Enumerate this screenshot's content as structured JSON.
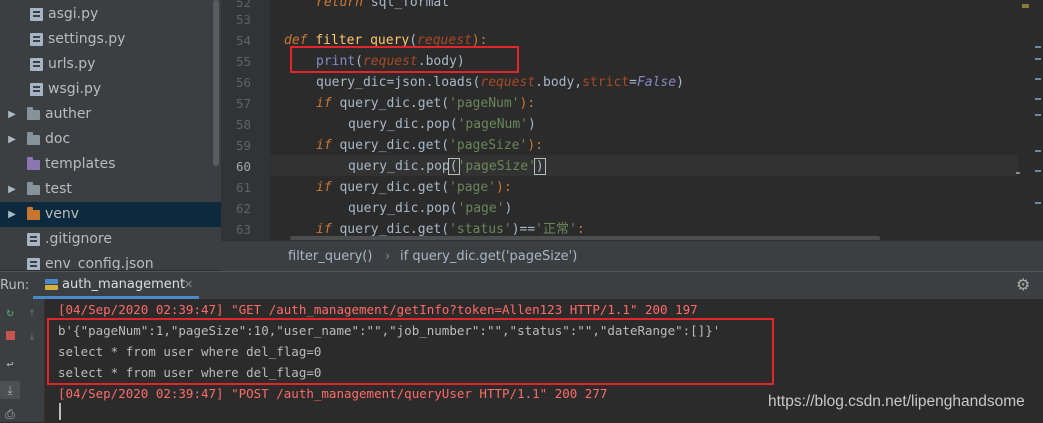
{
  "project_tree": {
    "items": [
      {
        "label": "asgi.py",
        "kind": "file"
      },
      {
        "label": "settings.py",
        "kind": "file"
      },
      {
        "label": "urls.py",
        "kind": "file"
      },
      {
        "label": "wsgi.py",
        "kind": "file"
      },
      {
        "label": "auther",
        "kind": "folder"
      },
      {
        "label": "doc",
        "kind": "folder"
      },
      {
        "label": "templates",
        "kind": "folder"
      },
      {
        "label": "test",
        "kind": "folder"
      },
      {
        "label": "venv",
        "kind": "folder"
      },
      {
        "label": ".gitignore",
        "kind": "file"
      },
      {
        "label": "env_config.json",
        "kind": "file"
      }
    ]
  },
  "editor": {
    "line_numbers": [
      "52",
      "53",
      "54",
      "55",
      "56",
      "57",
      "58",
      "59",
      "60",
      "61",
      "62",
      "63"
    ],
    "lines": {
      "l52": {
        "kw": "return",
        "rest": " sql_format"
      },
      "l54": {
        "kw": "def",
        "fn": "filter_query",
        "open": "(",
        "param": "request",
        "close": "):"
      },
      "l55": {
        "print": "print",
        "open": "(",
        "param": "request",
        "rest": ".body)"
      },
      "l56": {
        "a": "query_dic=json.loads(",
        "param": "request",
        "b": ".body,",
        "kwarg": "strict",
        "eq": "=",
        "const": "False",
        "c": ")"
      },
      "l57": {
        "kw": "if",
        "a": " query_dic.get(",
        "str": "'pageNum'",
        "b": "):"
      },
      "l58": {
        "a": "query_dic.pop(",
        "str": "'pageNum'",
        "b": ")"
      },
      "l59": {
        "kw": "if",
        "a": " query_dic.get(",
        "str": "'pageSize'",
        "b": "):"
      },
      "l60": {
        "a": "query_dic.pop",
        "open": "(",
        "str": "'pageSize'",
        "close": ")"
      },
      "l61": {
        "kw": "if",
        "a": " query_dic.get(",
        "str": "'page'",
        "b": "):"
      },
      "l62": {
        "a": "query_dic.pop(",
        "str": "'page'",
        "b": ")"
      },
      "l63": {
        "kw": "if",
        "a": " query_dic.get(",
        "str": "'status'",
        "b": ")==",
        "str2": "'正常'",
        "c": ":"
      }
    }
  },
  "breadcrumb": {
    "function": "filter_query()",
    "separator": "›",
    "statement": "if query_dic.get('pageSize')"
  },
  "run_panel": {
    "label": "Run:",
    "tab_label": "auth_management",
    "close_glyph": "✕",
    "console_lines": [
      {
        "text": "[04/Sep/2020 02:39:47] \"GET /auth_management/getInfo?token=Allen123 HTTP/1.1\" 200 197",
        "kind": "stderr"
      },
      {
        "text": "b'{\"pageNum\":1,\"pageSize\":10,\"user_name\":\"\",\"job_number\":\"\",\"status\":\"\",\"dateRange\":[]}'",
        "kind": "stdout"
      },
      {
        "text": "select * from user where del_flag=0",
        "kind": "stdout"
      },
      {
        "text": "select * from user where del_flag=0",
        "kind": "stdout"
      },
      {
        "text": "[04/Sep/2020 02:39:47] \"POST /auth_management/queryUser HTTP/1.1\" 200 277",
        "kind": "stderr"
      }
    ]
  },
  "watermark": "https://blog.csdn.net/lipenghandsome",
  "colors": {
    "red_box": "#e0262b",
    "keyword": "#cc7832",
    "string": "#6a8759",
    "param": "#aa4926",
    "function": "#ffc66d",
    "stderr": "#ff6b68"
  }
}
